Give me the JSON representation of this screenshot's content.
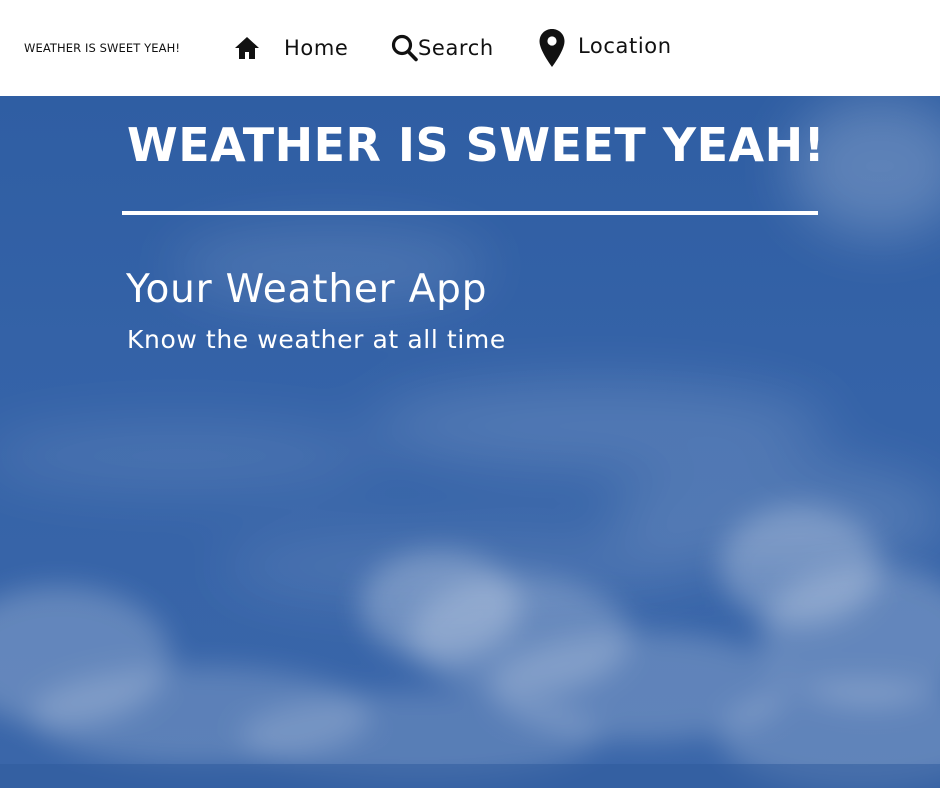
{
  "nav": {
    "brand": "WEATHER IS SWEET YEAH!",
    "items": [
      {
        "label": "Home",
        "icon": "home-icon"
      },
      {
        "label": "Search",
        "icon": "search-icon"
      },
      {
        "label": "Location",
        "icon": "map-pin-icon"
      }
    ]
  },
  "hero": {
    "title": "WEATHER IS SWEET YEAH!",
    "subtitle": "Your Weather App",
    "tagline": "Know the weather at all time"
  },
  "colors": {
    "nav_bg": "#ffffff",
    "text_dark": "#111111",
    "sky_blue": "#3563a8",
    "hero_text": "#ffffff"
  }
}
